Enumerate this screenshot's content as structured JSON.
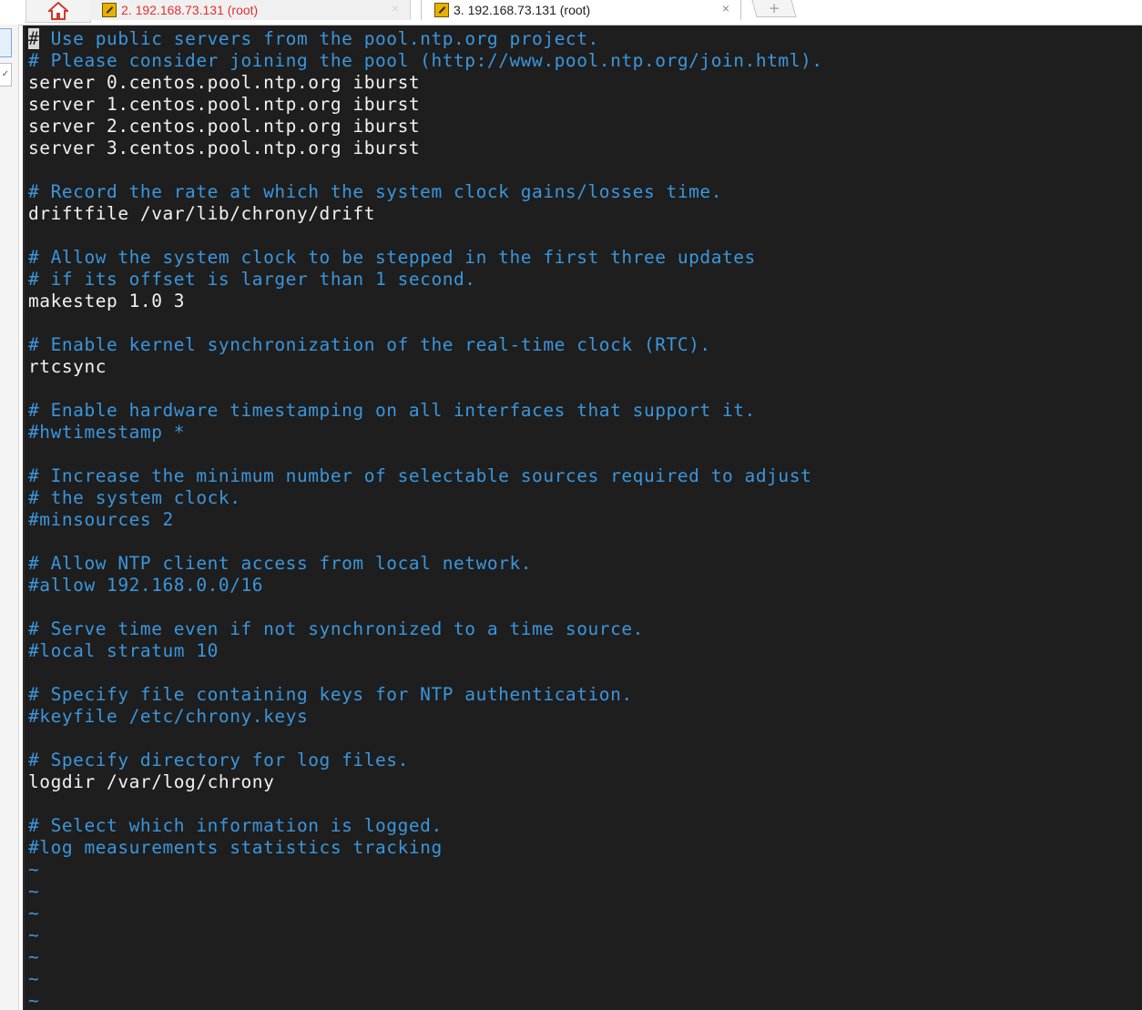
{
  "tabs": [
    {
      "label": "2. 192.168.73.131 (root)",
      "close": "×",
      "active": false
    },
    {
      "label": "3. 192.168.73.131 (root)",
      "close": "×",
      "active": true
    }
  ],
  "new_tab_glyph": "+",
  "home_icon": "home-icon",
  "colors": {
    "terminal_bg": "#1e1e1e",
    "comment": "#3b96dc",
    "text": "#f2f2f2",
    "inactive_tab_text": "#e03030"
  },
  "terminal": {
    "cursor_char": "#",
    "lines": [
      {
        "text": " Use public servers from the pool.ntp.org project.",
        "kind": "comment"
      },
      {
        "text": "# Please consider joining the pool (http://www.pool.ntp.org/join.html).",
        "kind": "comment"
      },
      {
        "text": "server 0.centos.pool.ntp.org iburst",
        "kind": "plain"
      },
      {
        "text": "server 1.centos.pool.ntp.org iburst",
        "kind": "plain"
      },
      {
        "text": "server 2.centos.pool.ntp.org iburst",
        "kind": "plain"
      },
      {
        "text": "server 3.centos.pool.ntp.org iburst",
        "kind": "plain"
      },
      {
        "text": "",
        "kind": "plain"
      },
      {
        "text": "# Record the rate at which the system clock gains/losses time.",
        "kind": "comment"
      },
      {
        "text": "driftfile /var/lib/chrony/drift",
        "kind": "plain"
      },
      {
        "text": "",
        "kind": "plain"
      },
      {
        "text": "# Allow the system clock to be stepped in the first three updates",
        "kind": "comment"
      },
      {
        "text": "# if its offset is larger than 1 second.",
        "kind": "comment"
      },
      {
        "text": "makestep 1.0 3",
        "kind": "plain"
      },
      {
        "text": "",
        "kind": "plain"
      },
      {
        "text": "# Enable kernel synchronization of the real-time clock (RTC).",
        "kind": "comment"
      },
      {
        "text": "rtcsync",
        "kind": "plain"
      },
      {
        "text": "",
        "kind": "plain"
      },
      {
        "text": "# Enable hardware timestamping on all interfaces that support it.",
        "kind": "comment"
      },
      {
        "text": "#hwtimestamp *",
        "kind": "comment"
      },
      {
        "text": "",
        "kind": "plain"
      },
      {
        "text": "# Increase the minimum number of selectable sources required to adjust",
        "kind": "comment"
      },
      {
        "text": "# the system clock.",
        "kind": "comment"
      },
      {
        "text": "#minsources 2",
        "kind": "comment"
      },
      {
        "text": "",
        "kind": "plain"
      },
      {
        "text": "# Allow NTP client access from local network.",
        "kind": "comment"
      },
      {
        "text": "#allow 192.168.0.0/16",
        "kind": "comment"
      },
      {
        "text": "",
        "kind": "plain"
      },
      {
        "text": "# Serve time even if not synchronized to a time source.",
        "kind": "comment"
      },
      {
        "text": "#local stratum 10",
        "kind": "comment"
      },
      {
        "text": "",
        "kind": "plain"
      },
      {
        "text": "# Specify file containing keys for NTP authentication.",
        "kind": "comment"
      },
      {
        "text": "#keyfile /etc/chrony.keys",
        "kind": "comment"
      },
      {
        "text": "",
        "kind": "plain"
      },
      {
        "text": "# Specify directory for log files.",
        "kind": "comment"
      },
      {
        "text": "logdir /var/log/chrony",
        "kind": "plain"
      },
      {
        "text": "",
        "kind": "plain"
      },
      {
        "text": "# Select which information is logged.",
        "kind": "comment"
      },
      {
        "text": "#log measurements statistics tracking",
        "kind": "comment"
      },
      {
        "text": "~",
        "kind": "tilde"
      },
      {
        "text": "~",
        "kind": "tilde"
      },
      {
        "text": "~",
        "kind": "tilde"
      },
      {
        "text": "~",
        "kind": "tilde"
      },
      {
        "text": "~",
        "kind": "tilde"
      },
      {
        "text": "~",
        "kind": "tilde"
      },
      {
        "text": "~",
        "kind": "tilde"
      }
    ]
  }
}
